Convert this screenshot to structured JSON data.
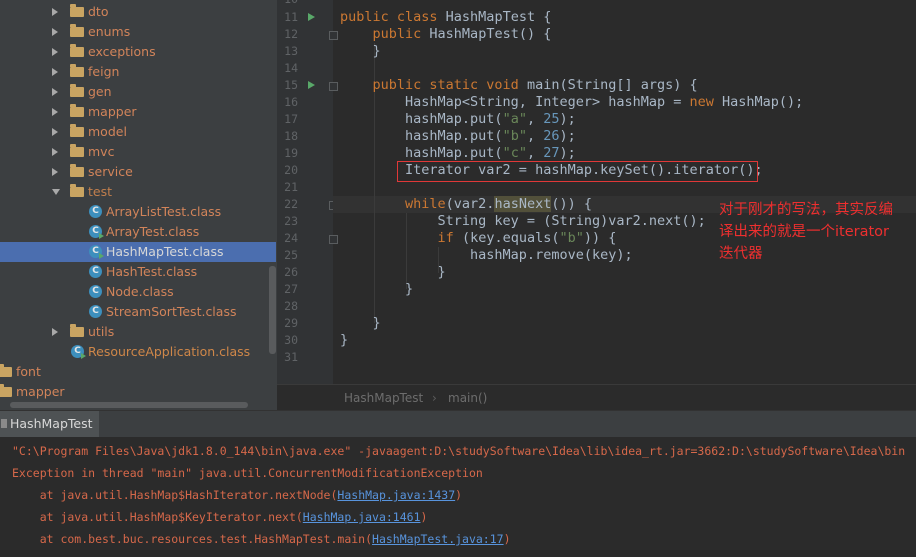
{
  "project_tree": {
    "items": [
      {
        "label": "dto",
        "kind": "folder",
        "expanded": false
      },
      {
        "label": "enums",
        "kind": "folder",
        "expanded": false
      },
      {
        "label": "exceptions",
        "kind": "folder",
        "expanded": false
      },
      {
        "label": "feign",
        "kind": "folder",
        "expanded": false
      },
      {
        "label": "gen",
        "kind": "folder",
        "expanded": false
      },
      {
        "label": "mapper",
        "kind": "folder",
        "expanded": false
      },
      {
        "label": "model",
        "kind": "folder",
        "expanded": false
      },
      {
        "label": "mvc",
        "kind": "folder",
        "expanded": false
      },
      {
        "label": "service",
        "kind": "folder",
        "expanded": false
      },
      {
        "label": "test",
        "kind": "folder",
        "expanded": true
      },
      {
        "label": "ArrayListTest.class",
        "kind": "class"
      },
      {
        "label": "ArrayTest.class",
        "kind": "class"
      },
      {
        "label": "HashMapTest.class",
        "kind": "class",
        "selected": true
      },
      {
        "label": "HashTest.class",
        "kind": "class"
      },
      {
        "label": "Node.class",
        "kind": "class"
      },
      {
        "label": "StreamSortTest.class",
        "kind": "class"
      },
      {
        "label": "utils",
        "kind": "folder",
        "expanded": false
      },
      {
        "label": "ResourceApplication.class",
        "kind": "class"
      },
      {
        "label": "font",
        "kind": "folder"
      },
      {
        "label": "mapper",
        "kind": "folder"
      }
    ]
  },
  "editor": {
    "line_numbers": [
      "10",
      "11",
      "12",
      "13",
      "14",
      "15",
      "16",
      "17",
      "18",
      "19",
      "20",
      "21",
      "22",
      "23",
      "24",
      "25",
      "26",
      "27",
      "28",
      "29",
      "30",
      "31"
    ],
    "annotation": "对于刚才的写法，其实反编译出来的就是一个iterator迭代器",
    "breadcrumb": [
      "HashMapTest",
      "main()"
    ],
    "colors": {
      "keyword": "#cc7832",
      "string": "#6a8759",
      "number": "#6897bb",
      "text": "#a9b7c6",
      "annotation": "#ee2f2f"
    }
  },
  "run_panel": {
    "tab_label": "HashMapTest",
    "console": {
      "command": "\"C:\\Program Files\\Java\\jdk1.8.0_144\\bin\\java.exe\" -javaagent:D:\\studySoftware\\Idea\\lib\\idea_rt.jar=3662:D:\\studySoftware\\Idea\\bin",
      "exception": "Exception in thread \"main\" java.util.ConcurrentModificationException",
      "stack": [
        {
          "prefix": "    at java.util.HashMap$HashIterator.nextNode(",
          "link": "HashMap.java:1437",
          "suffix": ")"
        },
        {
          "prefix": "    at java.util.HashMap$KeyIterator.next(",
          "link": "HashMap.java:1461",
          "suffix": ")"
        },
        {
          "prefix": "    at com.best.buc.resources.test.HashMapTest.main(",
          "link": "HashMapTest.java:17",
          "suffix": ")"
        }
      ]
    }
  }
}
